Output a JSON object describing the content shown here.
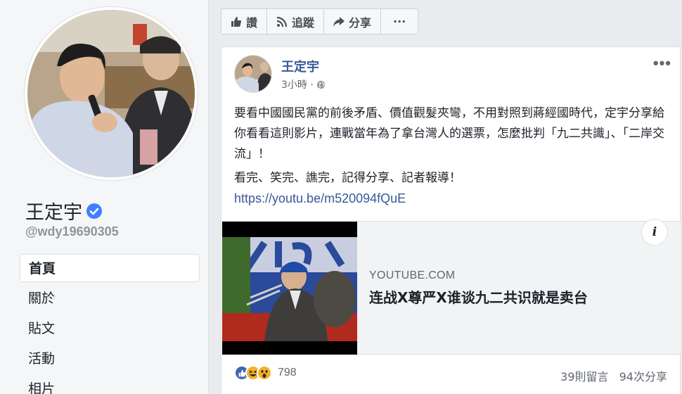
{
  "sidebar": {
    "page_name": "王定宇",
    "handle": "@wdy19690305",
    "nav": [
      {
        "label": "首頁",
        "active": true
      },
      {
        "label": "關於"
      },
      {
        "label": "貼文"
      },
      {
        "label": "活動"
      },
      {
        "label": "相片"
      }
    ]
  },
  "actions": {
    "like": "讚",
    "follow": "追蹤",
    "share": "分享",
    "more": "···"
  },
  "post": {
    "author": "王定宇",
    "time": "3小時 ·",
    "more": "•••",
    "paragraph1": "要看中國國民黨的前後矛盾、價值觀髮夾彎，不用對照到蔣經國時代，定宇分享給你看看這則影片，連戰當年為了拿台灣人的選票，怎麼批判「九二共識」、「二岸交流」！",
    "paragraph2": "看完、笑完、譙完，記得分享、記者報導！",
    "link": "https://youtu.be/m520094fQuE",
    "preview": {
      "source": "YOUTUBE.COM",
      "title": "连战X尊严X谁谈九二共识就是卖台",
      "info": "i"
    },
    "reaction_count": "798",
    "comments": "39則留言",
    "shares": "94次分享"
  },
  "colors": {
    "link_blue": "#385898",
    "like_blue": "#4267b2",
    "verified_blue": "#4080ff",
    "background": "#e9ebee"
  }
}
